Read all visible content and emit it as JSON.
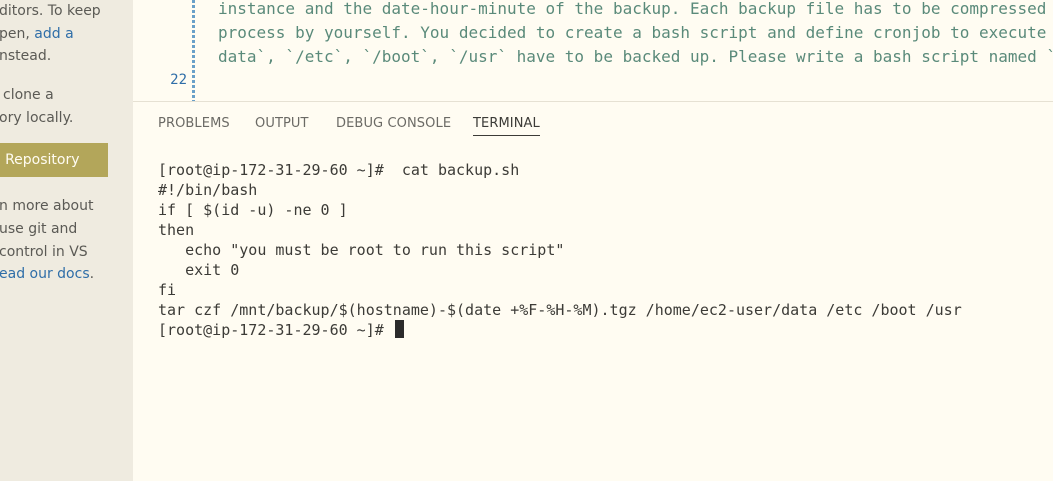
{
  "sidebar": {
    "lines": [
      "ditors. To keep",
      "pen, ",
      "nstead.",
      "clone a",
      "ory locally.",
      "n more about",
      "use git and",
      "control in VS",
      "ead our docs"
    ],
    "link_add": "add a",
    "link_docs_suffix": ".",
    "button_label": "e Repository"
  },
  "editor": {
    "line_number": "22",
    "lines": [
      "instance and the date-hour-minute of the backup. Each backup file has to be compressed",
      "process by yourself. You decided to create a bash script and define cronjob to execute",
      "data`, `/etc`, `/boot`, `/usr` have to be backed up. Please write a bash script named `"
    ]
  },
  "panel": {
    "tabs": [
      "PROBLEMS",
      "OUTPUT",
      "DEBUG CONSOLE",
      "TERMINAL"
    ],
    "active_tab": "TERMINAL"
  },
  "terminal": {
    "lines": [
      "[root@ip-172-31-29-60 ~]#  cat backup.sh",
      "#!/bin/bash",
      "if [ $(id -u) -ne 0 ]",
      "then",
      "   echo \"you must be root to run this script\"",
      "   exit 0",
      "fi",
      "tar czf /mnt/backup/$(hostname)-$(date +%F-%H-%M).tgz /home/ec2-user/data /etc /boot /usr"
    ],
    "prompt": "[root@ip-172-31-29-60 ~]# "
  },
  "colors": {
    "accent_button": "#b3a65a",
    "link": "#2f6ea8",
    "background": "#fffcf2",
    "sidebar_bg": "#efebe0"
  }
}
